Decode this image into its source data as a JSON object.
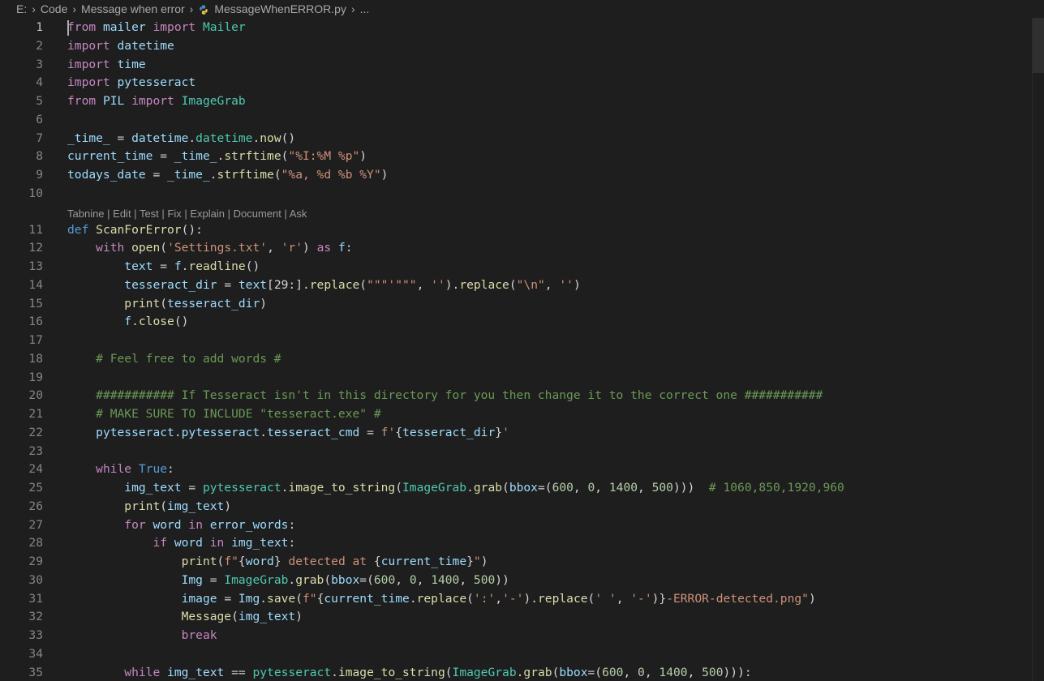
{
  "breadcrumb": {
    "items": [
      "E:",
      "Code",
      "Message when error"
    ],
    "file_label": "MessageWhenERROR.py",
    "trail": "...",
    "separator": "›"
  },
  "codelens": {
    "before_line": 11,
    "items": [
      "Tabnine",
      "Edit",
      "Test",
      "Fix",
      "Explain",
      "Document",
      "Ask"
    ],
    "separator": " | "
  },
  "active_line": 1,
  "colors": {
    "keyword": "#c586c0",
    "storage": "#569cd6",
    "identifier": "#9cdcfe",
    "function": "#dcdcaa",
    "class": "#4ec9b0",
    "string": "#ce9178",
    "number": "#b5cea8",
    "comment": "#6a9955",
    "default": "#d4d4d4"
  },
  "lines": [
    {
      "n": 1,
      "indent": 0,
      "tokens": [
        [
          "from",
          "kw"
        ],
        [
          " "
        ],
        [
          "mailer",
          "id"
        ],
        [
          " "
        ],
        [
          "import",
          "kw"
        ],
        [
          " "
        ],
        [
          "Mailer",
          "cls"
        ]
      ]
    },
    {
      "n": 2,
      "indent": 0,
      "tokens": [
        [
          "import",
          "kw"
        ],
        [
          " "
        ],
        [
          "datetime",
          "id"
        ]
      ]
    },
    {
      "n": 3,
      "indent": 0,
      "tokens": [
        [
          "import",
          "kw"
        ],
        [
          " "
        ],
        [
          "time",
          "id"
        ]
      ]
    },
    {
      "n": 4,
      "indent": 0,
      "tokens": [
        [
          "import",
          "kw"
        ],
        [
          " "
        ],
        [
          "pytesseract",
          "id"
        ]
      ]
    },
    {
      "n": 5,
      "indent": 0,
      "tokens": [
        [
          "from",
          "kw"
        ],
        [
          " "
        ],
        [
          "PIL",
          "id"
        ],
        [
          " "
        ],
        [
          "import",
          "kw"
        ],
        [
          " "
        ],
        [
          "ImageGrab",
          "cls"
        ]
      ]
    },
    {
      "n": 6,
      "indent": 0,
      "tokens": []
    },
    {
      "n": 7,
      "indent": 0,
      "tokens": [
        [
          "_time_",
          "id"
        ],
        [
          " = "
        ],
        [
          "datetime",
          "id"
        ],
        [
          "."
        ],
        [
          "datetime",
          "cls"
        ],
        [
          "."
        ],
        [
          "now",
          "fn"
        ],
        [
          "()"
        ]
      ]
    },
    {
      "n": 8,
      "indent": 0,
      "tokens": [
        [
          "current_time",
          "id"
        ],
        [
          " = "
        ],
        [
          "_time_",
          "id"
        ],
        [
          "."
        ],
        [
          "strftime",
          "fn"
        ],
        [
          "("
        ],
        [
          "\"%I:%M %p\"",
          "str"
        ],
        [
          ")"
        ]
      ]
    },
    {
      "n": 9,
      "indent": 0,
      "tokens": [
        [
          "todays_date",
          "id"
        ],
        [
          " = "
        ],
        [
          "_time_",
          "id"
        ],
        [
          "."
        ],
        [
          "strftime",
          "fn"
        ],
        [
          "("
        ],
        [
          "\"%a, %d %b %Y\"",
          "str"
        ],
        [
          ")"
        ]
      ]
    },
    {
      "n": 10,
      "indent": 0,
      "tokens": []
    },
    {
      "n": 11,
      "indent": 0,
      "tokens": [
        [
          "def",
          "st"
        ],
        [
          " "
        ],
        [
          "ScanForError",
          "fn"
        ],
        [
          "():"
        ]
      ]
    },
    {
      "n": 12,
      "indent": 1,
      "tokens": [
        [
          "with",
          "kw"
        ],
        [
          " "
        ],
        [
          "open",
          "fn"
        ],
        [
          "("
        ],
        [
          "'Settings.txt'",
          "str"
        ],
        [
          ", "
        ],
        [
          "'r'",
          "str"
        ],
        [
          ") "
        ],
        [
          "as",
          "kw"
        ],
        [
          " "
        ],
        [
          "f",
          "id"
        ],
        [
          ":"
        ]
      ]
    },
    {
      "n": 13,
      "indent": 2,
      "tokens": [
        [
          "text",
          "id"
        ],
        [
          " = "
        ],
        [
          "f",
          "id"
        ],
        [
          "."
        ],
        [
          "readline",
          "fn"
        ],
        [
          "()"
        ]
      ]
    },
    {
      "n": 14,
      "indent": 2,
      "tokens": [
        [
          "tesseract_dir",
          "id"
        ],
        [
          " = "
        ],
        [
          "text",
          "id"
        ],
        [
          "[29:]."
        ],
        [
          "replace",
          "fn"
        ],
        [
          "("
        ],
        [
          "\"\"\"'\"\"\"",
          "str"
        ],
        [
          ", "
        ],
        [
          "''",
          "str"
        ],
        [
          ")."
        ],
        [
          "replace",
          "fn"
        ],
        [
          "("
        ],
        [
          "\"\\n\"",
          "str"
        ],
        [
          ", "
        ],
        [
          "''",
          "str"
        ],
        [
          ")"
        ]
      ]
    },
    {
      "n": 15,
      "indent": 2,
      "tokens": [
        [
          "print",
          "fn"
        ],
        [
          "("
        ],
        [
          "tesseract_dir",
          "id"
        ],
        [
          ")"
        ]
      ]
    },
    {
      "n": 16,
      "indent": 2,
      "tokens": [
        [
          "f",
          "id"
        ],
        [
          "."
        ],
        [
          "close",
          "fn"
        ],
        [
          "()"
        ]
      ]
    },
    {
      "n": 17,
      "indent": 0,
      "tokens": []
    },
    {
      "n": 18,
      "indent": 1,
      "tokens": [
        [
          "# Feel free to add words #",
          "cm"
        ]
      ]
    },
    {
      "n": 19,
      "indent": 0,
      "tokens": []
    },
    {
      "n": 20,
      "indent": 1,
      "tokens": [
        [
          "########### If Tesseract isn't in this directory for you then change it to the correct one ###########",
          "cm"
        ]
      ]
    },
    {
      "n": 21,
      "indent": 1,
      "tokens": [
        [
          "# MAKE SURE TO INCLUDE \"tesseract.exe\" #",
          "cm"
        ]
      ]
    },
    {
      "n": 22,
      "indent": 1,
      "tokens": [
        [
          "pytesseract",
          "id"
        ],
        [
          "."
        ],
        [
          "pytesseract",
          "id"
        ],
        [
          "."
        ],
        [
          "tesseract_cmd",
          "id"
        ],
        [
          " = "
        ],
        [
          "f'",
          "str"
        ],
        [
          "{"
        ],
        [
          "tesseract_dir",
          "id"
        ],
        [
          "}"
        ],
        [
          "'",
          "str"
        ]
      ]
    },
    {
      "n": 23,
      "indent": 0,
      "tokens": []
    },
    {
      "n": 24,
      "indent": 1,
      "tokens": [
        [
          "while",
          "kw"
        ],
        [
          " "
        ],
        [
          "True",
          "st"
        ],
        [
          ":"
        ]
      ]
    },
    {
      "n": 25,
      "indent": 2,
      "tokens": [
        [
          "img_text",
          "id"
        ],
        [
          " = "
        ],
        [
          "pytesseract",
          "cls"
        ],
        [
          "."
        ],
        [
          "image_to_string",
          "fn"
        ],
        [
          "("
        ],
        [
          "ImageGrab",
          "cls"
        ],
        [
          "."
        ],
        [
          "grab",
          "fn"
        ],
        [
          "("
        ],
        [
          "bbox",
          "id"
        ],
        [
          "=("
        ],
        [
          "600",
          "num"
        ],
        [
          ", "
        ],
        [
          "0",
          "num"
        ],
        [
          ", "
        ],
        [
          "1400",
          "num"
        ],
        [
          ", "
        ],
        [
          "500",
          "num"
        ],
        [
          ")))  "
        ],
        [
          "# 1060,850,1920,960",
          "cm"
        ]
      ]
    },
    {
      "n": 26,
      "indent": 2,
      "tokens": [
        [
          "print",
          "fn"
        ],
        [
          "("
        ],
        [
          "img_text",
          "id"
        ],
        [
          ")"
        ]
      ]
    },
    {
      "n": 27,
      "indent": 2,
      "tokens": [
        [
          "for",
          "kw"
        ],
        [
          " "
        ],
        [
          "word",
          "id"
        ],
        [
          " "
        ],
        [
          "in",
          "kw"
        ],
        [
          " "
        ],
        [
          "error_words",
          "id"
        ],
        [
          ":"
        ]
      ]
    },
    {
      "n": 28,
      "indent": 3,
      "tokens": [
        [
          "if",
          "kw"
        ],
        [
          " "
        ],
        [
          "word",
          "id"
        ],
        [
          " "
        ],
        [
          "in",
          "kw"
        ],
        [
          " "
        ],
        [
          "img_text",
          "id"
        ],
        [
          ":"
        ]
      ]
    },
    {
      "n": 29,
      "indent": 4,
      "tokens": [
        [
          "print",
          "fn"
        ],
        [
          "("
        ],
        [
          "f\"",
          "str"
        ],
        [
          "{"
        ],
        [
          "word",
          "id"
        ],
        [
          "}"
        ],
        [
          " detected at ",
          "str"
        ],
        [
          "{"
        ],
        [
          "current_time",
          "id"
        ],
        [
          "}"
        ],
        [
          "\"",
          "str"
        ],
        [
          ")"
        ]
      ]
    },
    {
      "n": 30,
      "indent": 4,
      "tokens": [
        [
          "Img",
          "id"
        ],
        [
          " = "
        ],
        [
          "ImageGrab",
          "cls"
        ],
        [
          "."
        ],
        [
          "grab",
          "fn"
        ],
        [
          "("
        ],
        [
          "bbox",
          "id"
        ],
        [
          "=("
        ],
        [
          "600",
          "num"
        ],
        [
          ", "
        ],
        [
          "0",
          "num"
        ],
        [
          ", "
        ],
        [
          "1400",
          "num"
        ],
        [
          ", "
        ],
        [
          "500",
          "num"
        ],
        [
          "))"
        ]
      ]
    },
    {
      "n": 31,
      "indent": 4,
      "tokens": [
        [
          "image",
          "id"
        ],
        [
          " = "
        ],
        [
          "Img",
          "id"
        ],
        [
          "."
        ],
        [
          "save",
          "fn"
        ],
        [
          "("
        ],
        [
          "f\"",
          "str"
        ],
        [
          "{"
        ],
        [
          "current_time",
          "id"
        ],
        [
          "."
        ],
        [
          "replace",
          "fn"
        ],
        [
          "("
        ],
        [
          "':'",
          "str"
        ],
        [
          ","
        ],
        [
          "'-'",
          "str"
        ],
        [
          ")."
        ],
        [
          "replace",
          "fn"
        ],
        [
          "("
        ],
        [
          "' '",
          "str"
        ],
        [
          ", "
        ],
        [
          "'-'",
          "str"
        ],
        [
          ")}"
        ],
        [
          "-ERROR-detected.png\"",
          "str"
        ],
        [
          ")"
        ]
      ]
    },
    {
      "n": 32,
      "indent": 4,
      "tokens": [
        [
          "Message",
          "fn"
        ],
        [
          "("
        ],
        [
          "img_text",
          "id"
        ],
        [
          ")"
        ]
      ]
    },
    {
      "n": 33,
      "indent": 4,
      "tokens": [
        [
          "break",
          "kw"
        ]
      ]
    },
    {
      "n": 34,
      "indent": 0,
      "tokens": []
    },
    {
      "n": 35,
      "indent": 2,
      "tokens": [
        [
          "while",
          "kw"
        ],
        [
          " "
        ],
        [
          "img_text",
          "id"
        ],
        [
          " == "
        ],
        [
          "pytesseract",
          "cls"
        ],
        [
          "."
        ],
        [
          "image_to_string",
          "fn"
        ],
        [
          "("
        ],
        [
          "ImageGrab",
          "cls"
        ],
        [
          "."
        ],
        [
          "grab",
          "fn"
        ],
        [
          "("
        ],
        [
          "bbox",
          "id"
        ],
        [
          "=("
        ],
        [
          "600",
          "num"
        ],
        [
          ", "
        ],
        [
          "0",
          "num"
        ],
        [
          ", "
        ],
        [
          "1400",
          "num"
        ],
        [
          ", "
        ],
        [
          "500",
          "num"
        ],
        [
          "))):"
        ]
      ]
    }
  ]
}
